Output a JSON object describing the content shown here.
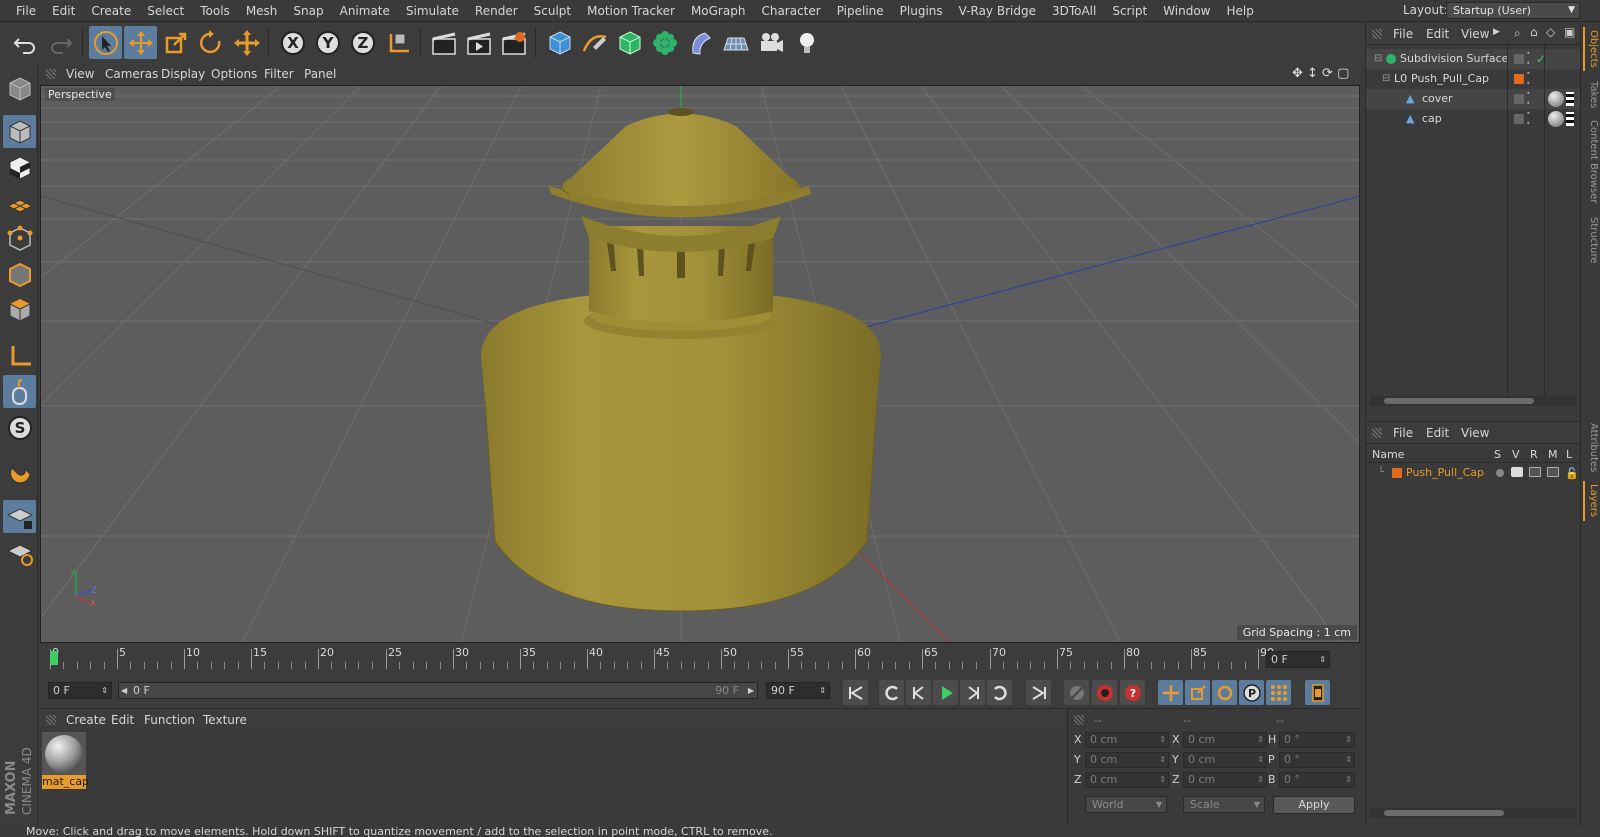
{
  "menubar": {
    "items": [
      "File",
      "Edit",
      "Create",
      "Select",
      "Tools",
      "Mesh",
      "Snap",
      "Animate",
      "Simulate",
      "Render",
      "Sculpt",
      "Motion Tracker",
      "MoGraph",
      "Character",
      "Pipeline",
      "Plugins",
      "V-Ray Bridge",
      "3DToAll",
      "Script",
      "Window",
      "Help"
    ],
    "layout_label": "Layout:",
    "layout_value": "Startup (User)"
  },
  "viewport": {
    "menu": [
      "View",
      "Cameras",
      "Display",
      "Options",
      "Filter",
      "Panel"
    ],
    "label": "Perspective",
    "grid_spacing": "Grid Spacing : 1 cm",
    "axis_labels": {
      "y": "Y",
      "z": "Z",
      "x": "X"
    }
  },
  "timeline": {
    "ticks": [
      "0",
      "5",
      "10",
      "15",
      "20",
      "25",
      "30",
      "35",
      "40",
      "45",
      "50",
      "55",
      "60",
      "65",
      "70",
      "75",
      "80",
      "85",
      "90"
    ],
    "current_frame_right": "0 F",
    "current_frame": "0 F",
    "range_start": "0 F",
    "range_end_inner": "90 F",
    "range_end": "90 F"
  },
  "material_manager": {
    "menu": [
      "Create",
      "Edit",
      "Function",
      "Texture"
    ],
    "materials": [
      {
        "name": "mat_cap"
      }
    ]
  },
  "coordinates": {
    "headers": [
      "--",
      "--",
      "--"
    ],
    "rows": [
      {
        "l1": "X",
        "v1": "0 cm",
        "l2": "X",
        "v2": "0 cm",
        "l3": "H",
        "v3": "0 °"
      },
      {
        "l1": "Y",
        "v1": "0 cm",
        "l2": "Y",
        "v2": "0 cm",
        "l3": "P",
        "v3": "0 °"
      },
      {
        "l1": "Z",
        "v1": "0 cm",
        "l2": "Z",
        "v2": "0 cm",
        "l3": "B",
        "v3": "0 °"
      }
    ],
    "mode_select": "World",
    "scale_select": "Scale",
    "apply": "Apply"
  },
  "status": "Move: Click and drag to move elements. Hold down SHIFT to quantize movement / add to the selection in point mode, CTRL to remove.",
  "object_manager": {
    "menu": [
      "File",
      "Edit",
      "View"
    ],
    "objects": [
      {
        "name": "Subdivision Surface"
      },
      {
        "name": "Push_Pull_Cap"
      },
      {
        "name": "cover"
      },
      {
        "name": "cap"
      }
    ]
  },
  "layer_manager": {
    "menu": [
      "File",
      "Edit",
      "View"
    ],
    "columns": {
      "name": "Name",
      "s": "S",
      "v": "V",
      "r": "R",
      "m": "M",
      "l": "L"
    },
    "layers": [
      {
        "name": "Push_Pull_Cap"
      }
    ]
  },
  "right_tabs": [
    "Objects",
    "Takes",
    "Content Browser",
    "Structure",
    "Attributes",
    "Layers"
  ],
  "logo": {
    "brand": "MAXON",
    "product": "CINEMA 4D"
  },
  "colors": {
    "accent": "#e89b2a",
    "selected": "#5c7d9e",
    "model": "#9a8a35",
    "layer_swatch": "#e06b1e"
  }
}
